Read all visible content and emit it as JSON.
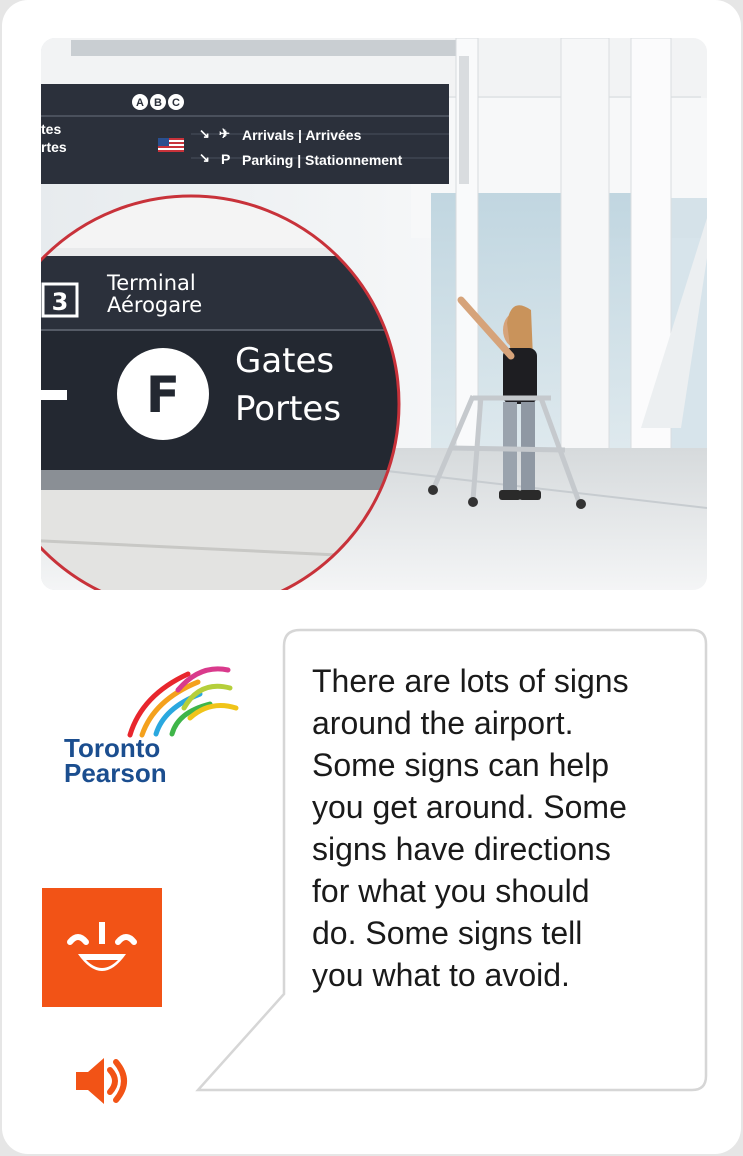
{
  "photo": {
    "overhead_sign": {
      "terminals": [
        "A",
        "B",
        "C"
      ],
      "partial_left_lines": [
        "tes",
        "rtes"
      ],
      "arrivals": "Arrivals | Arrivées",
      "parking_letter": "P",
      "parking": "Parking | Stationnement"
    },
    "zoom_sign": {
      "terminal_number": "3",
      "terminal_en": "Terminal",
      "terminal_fr": "Aérogare",
      "gate_letter": "F",
      "gates_en": "Gates",
      "gates_fr": "Portes"
    }
  },
  "logo": {
    "line1": "Toronto",
    "line2": "Pearson"
  },
  "app_icon": "smiling-face-icon",
  "speaker_icon": "speaker-icon",
  "message": "There are lots of signs\naround the airport.\nSome signs can help\nyou get around. Some\nsigns have directions\nfor what you should\ndo.  Some signs tell\nyou what to avoid.",
  "colors": {
    "accent_orange": "#f25316",
    "logo_blue": "#1b4e8f",
    "sign_navy": "#2b303b",
    "zoom_ring_red": "#c8323a"
  }
}
